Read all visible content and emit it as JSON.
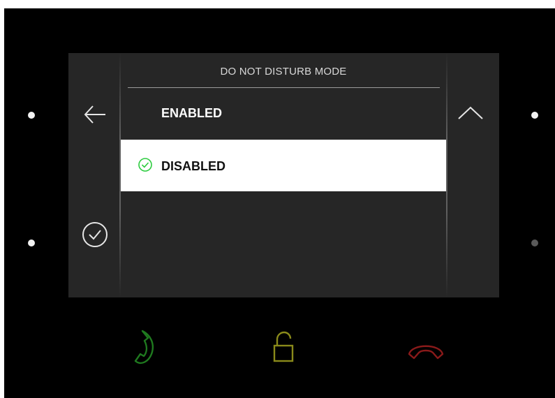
{
  "screen": {
    "title": "DO NOT DISTURB MODE",
    "options": [
      {
        "label": "ENABLED",
        "selected": false
      },
      {
        "label": "DISABLED",
        "selected": true
      }
    ]
  },
  "icons": {
    "back": "arrow-left-icon",
    "confirm": "check-circle-icon",
    "scroll_up": "chevron-up-icon",
    "selected_marker": "check-circle-icon",
    "call": "phone-icon",
    "unlock": "unlock-icon",
    "hangup": "hang-up-icon"
  },
  "colors": {
    "screen_bg": "#262626",
    "device_bg": "#000000",
    "selected_bg": "#ffffff",
    "check_green": "#2ecc40",
    "call_green": "#1f7a1f",
    "unlock_yellow": "#8a8a1a",
    "hangup_red": "#8a1a1a"
  },
  "leds": {
    "left_top": "on",
    "left_bottom": "on",
    "right_top": "on",
    "right_bottom": "dim"
  }
}
